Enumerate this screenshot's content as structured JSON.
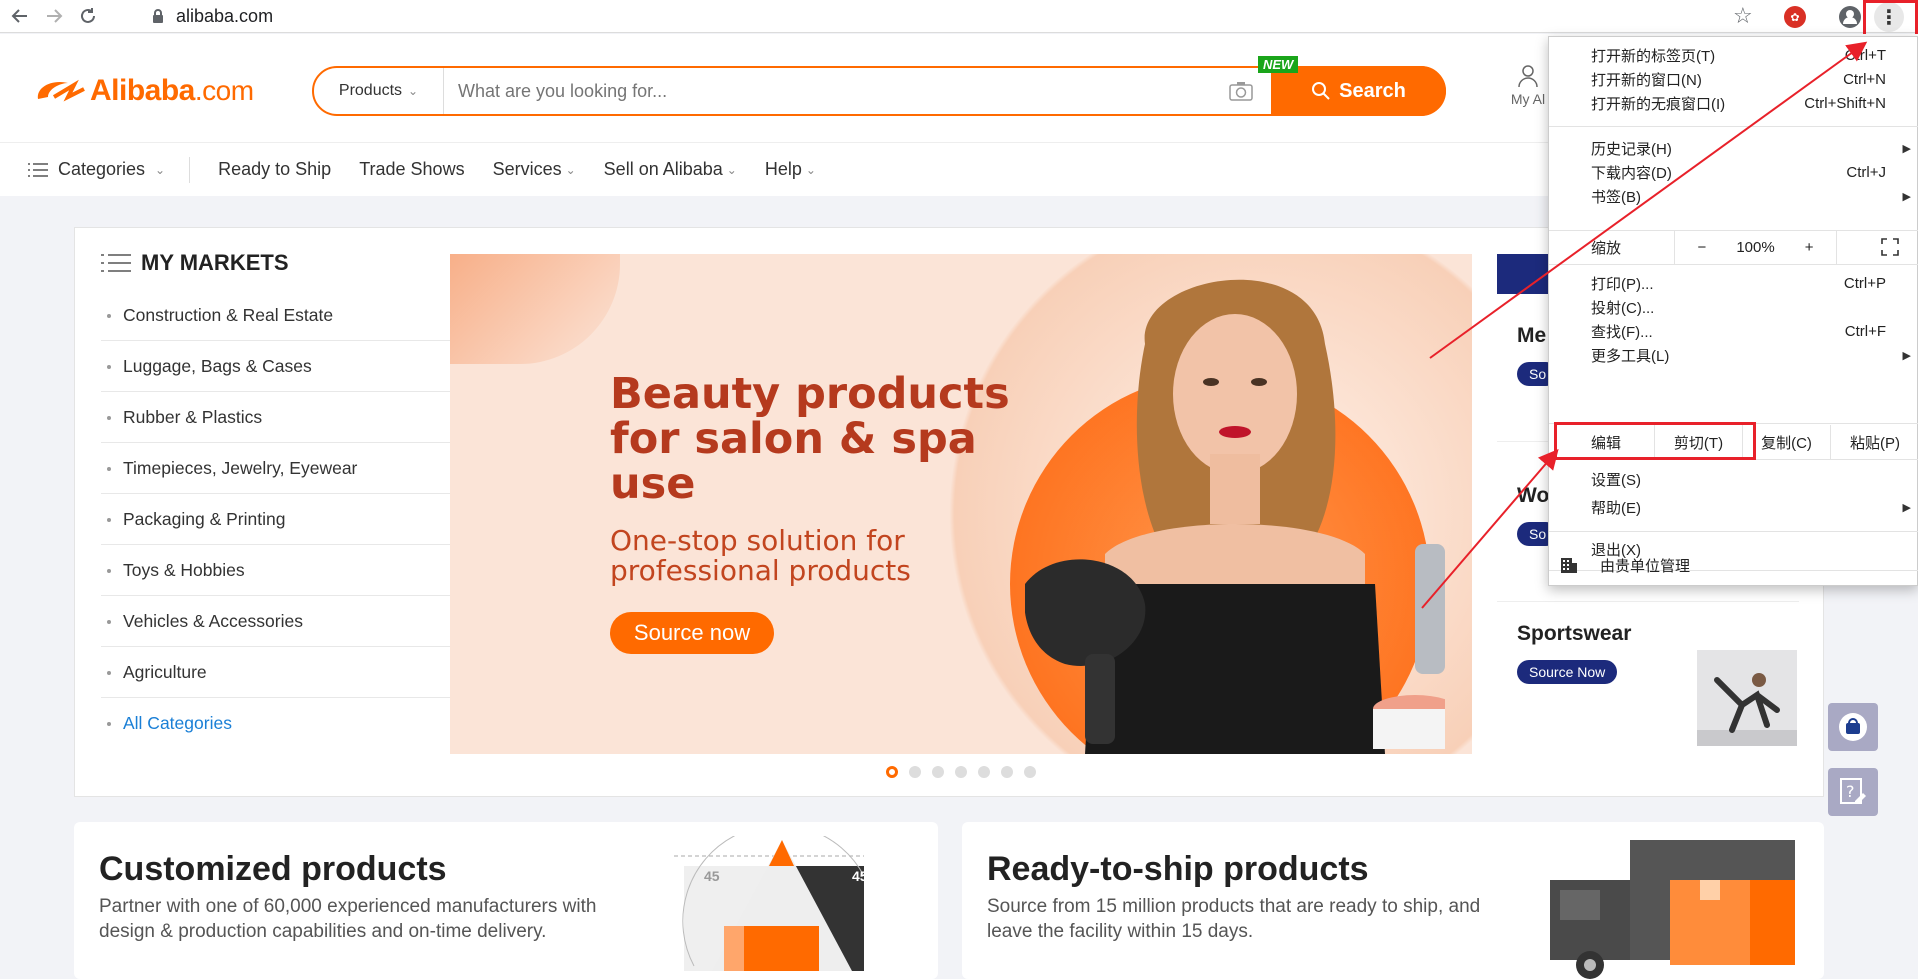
{
  "browser": {
    "url": "alibaba.com"
  },
  "header": {
    "logo_main": "Alibaba",
    "logo_suffix": ".com",
    "search_category": "Products",
    "search_placeholder": "What are you looking for...",
    "search_button": "Search",
    "new_badge": "NEW",
    "my_alibaba_partial": "My Al"
  },
  "subnav": {
    "categories": "Categories",
    "items": [
      {
        "label": "Ready to Ship"
      },
      {
        "label": "Trade Shows"
      },
      {
        "label": "Services"
      },
      {
        "label": "Sell on Alibaba"
      },
      {
        "label": "Help"
      }
    ]
  },
  "markets": {
    "title": "MY MARKETS",
    "items": [
      "Construction & Real Estate",
      "Luggage, Bags & Cases",
      "Rubber & Plastics",
      "Timepieces, Jewelry, Eyewear",
      "Packaging & Printing",
      "Toys & Hobbies",
      "Vehicles & Accessories",
      "Agriculture"
    ],
    "all_categories": "All Categories"
  },
  "banner": {
    "title": "Beauty products for salon & spa use",
    "subtitle": "One-stop solution for professional products",
    "button": "Source now",
    "slide_count": 7,
    "active_slide": 1
  },
  "right_column": {
    "cards": [
      {
        "title": "Me",
        "button": "So"
      },
      {
        "title": "Wo",
        "button": "So"
      },
      {
        "title": "Sportswear",
        "button": "Source Now"
      }
    ]
  },
  "bottom": {
    "customized": {
      "title": "Customized products",
      "desc1": "Partner with one of 60,000 experienced manufacturers with",
      "desc2": "design & production capabilities and on-time delivery.",
      "num_left": "45",
      "num_right": "45"
    },
    "ready": {
      "title": "Ready-to-ship products",
      "desc1": "Source from 15 million products that are ready to ship, and",
      "desc2": "leave the facility within 15 days."
    }
  },
  "menu": {
    "new_tab": {
      "label": "打开新的标签页(T)",
      "shortcut": "Ctrl+T"
    },
    "new_window": {
      "label": "打开新的窗口(N)",
      "shortcut": "Ctrl+N"
    },
    "incognito": {
      "label": "打开新的无痕窗口(I)",
      "shortcut": "Ctrl+Shift+N"
    },
    "history": {
      "label": "历史记录(H)"
    },
    "downloads": {
      "label": "下载内容(D)",
      "shortcut": "Ctrl+J"
    },
    "bookmarks": {
      "label": "书签(B)"
    },
    "zoom": {
      "label": "缩放",
      "minus": "−",
      "value": "100%",
      "plus": "+"
    },
    "print": {
      "label": "打印(P)...",
      "shortcut": "Ctrl+P"
    },
    "cast": {
      "label": "投射(C)..."
    },
    "find": {
      "label": "查找(F)...",
      "shortcut": "Ctrl+F"
    },
    "more_tools": {
      "label": "更多工具(L)"
    },
    "edit": {
      "label": "编辑",
      "cut": "剪切(T)",
      "copy": "复制(C)",
      "paste": "粘贴(P)"
    },
    "settings": {
      "label": "设置(S)"
    },
    "help": {
      "label": "帮助(E)"
    },
    "exit": {
      "label": "退出(X)"
    },
    "managed": {
      "label": "由贵单位管理"
    }
  },
  "colors": {
    "brand": "#ff6a00",
    "navy": "#1c2a7c",
    "annotation_red": "#e8212a"
  }
}
